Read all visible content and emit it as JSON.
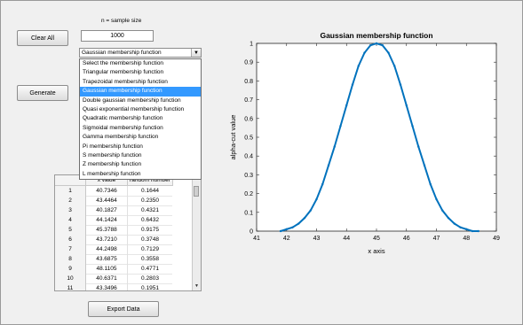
{
  "controls": {
    "clear_label": "Clear All",
    "generate_label": "Generate",
    "export_label": "Export Data",
    "sample_size_caption": "n = sample size",
    "sample_size_value": "1000",
    "membership_selected": "Gaussian membership function"
  },
  "dropdown": {
    "items": [
      "Select the membership function",
      "Triangular  membership function",
      "Trapezoidal membership function",
      "Gaussian membership function",
      "Double gaussian membership function",
      "Quasi exponential membership function",
      "Quadratic membership function",
      "Sigmoidal membership function",
      "Gamma membership function",
      "Pi membership function",
      "S membership function",
      "Z membership function",
      "L membership function"
    ],
    "active_index": 3
  },
  "table": {
    "headers": [
      "x value",
      "random number"
    ],
    "rows": [
      {
        "n": "1",
        "x": "40.7346",
        "r": "0.1644"
      },
      {
        "n": "2",
        "x": "43.4464",
        "r": "0.2350"
      },
      {
        "n": "3",
        "x": "40.1827",
        "r": "0.4321"
      },
      {
        "n": "4",
        "x": "44.1424",
        "r": "0.6432"
      },
      {
        "n": "5",
        "x": "45.3788",
        "r": "0.9175"
      },
      {
        "n": "6",
        "x": "43.7210",
        "r": "0.3748"
      },
      {
        "n": "7",
        "x": "44.2498",
        "r": "0.7129"
      },
      {
        "n": "8",
        "x": "43.6875",
        "r": "0.3558"
      },
      {
        "n": "9",
        "x": "48.1105",
        "r": "0.4771"
      },
      {
        "n": "10",
        "x": "40.6371",
        "r": "0.2803"
      },
      {
        "n": "11",
        "x": "43.3496",
        "r": "0.1951"
      }
    ]
  },
  "chart_data": {
    "type": "scatter",
    "title": "Gaussian membership function",
    "xlabel": "x axis",
    "ylabel": "alpha-cut value",
    "xlim": [
      41,
      49
    ],
    "ylim": [
      0,
      1
    ],
    "xticks": [
      "41",
      "42",
      "43",
      "44",
      "45",
      "46",
      "47",
      "48",
      "49"
    ],
    "yticks": [
      "0",
      "0.1",
      "0.2",
      "0.3",
      "0.4",
      "0.5",
      "0.6",
      "0.7",
      "0.8",
      "0.9",
      "1"
    ],
    "color": "#0072bd",
    "series": [
      {
        "x": [
          41.8,
          42.0,
          42.2,
          42.4,
          42.6,
          42.8,
          43.0,
          43.2,
          43.4,
          43.6,
          43.8,
          44.0,
          44.2,
          44.4,
          44.6,
          44.8,
          45.0,
          45.2,
          45.4,
          45.6,
          45.8,
          46.0,
          46.2,
          46.4,
          46.6,
          46.8,
          47.0,
          47.2,
          47.4,
          47.6,
          47.8,
          48.0,
          48.2,
          48.4
        ],
        "y": [
          0.0,
          0.01,
          0.02,
          0.04,
          0.07,
          0.11,
          0.17,
          0.25,
          0.35,
          0.45,
          0.56,
          0.67,
          0.78,
          0.88,
          0.95,
          0.99,
          1.0,
          0.99,
          0.95,
          0.88,
          0.78,
          0.67,
          0.56,
          0.45,
          0.35,
          0.25,
          0.17,
          0.11,
          0.07,
          0.04,
          0.02,
          0.01,
          0.0,
          0.0
        ]
      }
    ]
  }
}
